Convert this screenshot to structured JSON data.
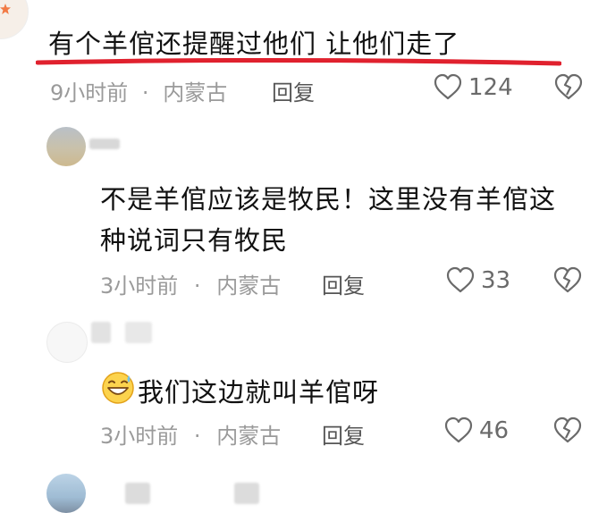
{
  "comments": [
    {
      "text": "有个羊倌还提醒过他们 让他们走了",
      "time": "9小时前",
      "location": "内蒙古",
      "reply_label": "回复",
      "likes": "124"
    },
    {
      "text_line1": "不是羊倌应该是牧民！这里没有羊倌这",
      "text_line2": "种说词只有牧民",
      "time": "3小时前",
      "location": "内蒙古",
      "reply_label": "回复",
      "likes": "33"
    },
    {
      "emoji": "grinning-sweat-emoji",
      "text": "我们这边就叫羊倌呀",
      "time": "3小时前",
      "location": "内蒙古",
      "reply_label": "回复",
      "likes": "46"
    }
  ],
  "separator": "·",
  "colors": {
    "underline": "#e0212e",
    "meta": "#9a9a9a"
  },
  "icons": {
    "like": "heart-outline-icon",
    "dislike": "broken-heart-icon"
  }
}
